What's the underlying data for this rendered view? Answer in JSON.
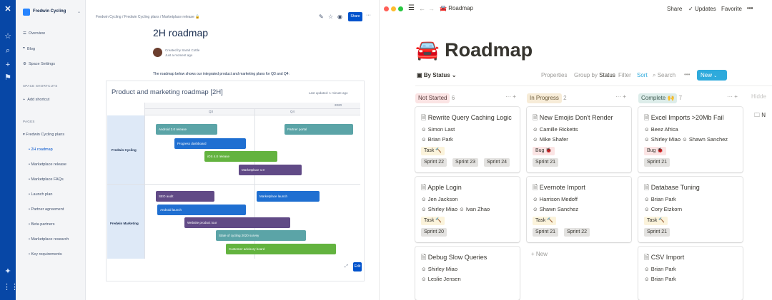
{
  "confluence": {
    "space_name": "Fredwin Cycling",
    "space_nav": [
      "Overview",
      "Blog",
      "Space Settings"
    ],
    "shortcuts_heading": "SPACE SHORTCUTS",
    "add_shortcut": "Add shortcut",
    "pages_heading": "PAGES",
    "page_tree_root": "Fredwin Cycling plans",
    "page_tree": [
      "2H roadmap",
      "Marketplace release",
      "Marketplace FAQs",
      "Launch plan",
      "Partner agreement",
      "Beta partners",
      "Marketplace research",
      "Key requirements"
    ],
    "breadcrumb": "Fredwin Cycling  /  Fredwin Cycling plans  /  Marketplace release",
    "share_label": "Share",
    "page_title": "2H roadmap",
    "author": "Created by Sarah Cottle",
    "time": "Just a moment ago",
    "intro": "The roadmap below shows our integrated product and marketing plans for Q3 and Q4:",
    "roadmap_title": "Product and marketing roadmap [2H]",
    "last_updated": "Last updated: 1 minute ago",
    "year": "2020",
    "quarters": [
      "Q3",
      "Q4"
    ],
    "lanes": [
      "Fredwin Cycling",
      "Fredwin Marketing"
    ],
    "bars": [
      {
        "label": "Android 3.0 release",
        "color": "#5ba4a7"
      },
      {
        "label": "Partner portal",
        "color": "#5ba4a7"
      },
      {
        "label": "Progress dashboard",
        "color": "#1f6fd1"
      },
      {
        "label": "iOS 4.0 release",
        "color": "#63b33f"
      },
      {
        "label": "Marketplace 1.0",
        "color": "#614a86"
      },
      {
        "label": "SEO audit",
        "color": "#614a86"
      },
      {
        "label": "Marketplace launch",
        "color": "#1f6fd1"
      },
      {
        "label": "Android launch",
        "color": "#1f6fd1"
      },
      {
        "label": "Website product tour",
        "color": "#614a86"
      },
      {
        "label": "State of cycling 2020 survey",
        "color": "#5ba4a7"
      },
      {
        "label": "Customer advisory board",
        "color": "#63b33f"
      }
    ],
    "edit_label": "Edit"
  },
  "notion": {
    "title_icon": "🚘",
    "breadcrumb_title": "Roadmap",
    "top_actions": [
      "Share",
      "Updates",
      "Favorite",
      "•••"
    ],
    "page_title": "Roadmap",
    "view_label": "By Status",
    "toolbar": {
      "properties": "Properties",
      "group_by": "Group by",
      "group_value": "Status",
      "filter": "Filter",
      "sort": "Sort",
      "search": "Search",
      "more": "•••",
      "new": "New"
    },
    "columns": [
      {
        "name": "Not Started",
        "count": "6",
        "bg": "#fbe4e4",
        "color": "#5a3d3d"
      },
      {
        "name": "In Progress",
        "count": "2",
        "bg": "#f7ecd8",
        "color": "#6b5a3a"
      },
      {
        "name": "Complete 🙌",
        "count": "7",
        "bg": "#ddedea",
        "color": "#3d5a50"
      }
    ],
    "hidden_label": "Hidde",
    "add_new": "+ New",
    "cards": [
      {
        "title": "Rewrite Query Caching Logic",
        "people": [
          "Simon Last",
          "Brian Park"
        ],
        "type": "Task 🔨",
        "sprints": [
          "Sprint 22",
          "Sprint 23",
          "Sprint 24"
        ]
      },
      {
        "title": "Apple Login",
        "people": [
          "Jen Jackson",
          "Shirley Miao",
          "Ivan Zhao"
        ],
        "type": "Task 🔨",
        "sprints": [
          "Sprint 20"
        ]
      },
      {
        "title": "Debug Slow Queries",
        "people": [
          "Shirley Miao",
          "Leslie Jensen"
        ]
      },
      {
        "title": "New Emojis Don't Render",
        "people": [
          "Camille Ricketts",
          "Mike Shafer"
        ],
        "type": "Bug 🐞",
        "sprints": [
          "Sprint 21"
        ]
      },
      {
        "title": "Evernote Import",
        "people": [
          "Harrison Medoff",
          "Shawn Sanchez"
        ],
        "type": "Task 🔨",
        "sprints": [
          "Sprint 21",
          "Sprint 22"
        ]
      },
      {
        "title": "Excel Imports >20Mb Fail",
        "people": [
          "Beez Africa",
          "Shirley Miao",
          "Shawn Sanchez"
        ],
        "type": "Bug 🐞",
        "sprints": [
          "Sprint 21"
        ]
      },
      {
        "title": "Database Tuning",
        "people": [
          "Brian Park",
          "Cory Etzkorn"
        ],
        "type": "Task 🔨",
        "sprints": [
          "Sprint 21"
        ]
      },
      {
        "title": "CSV Import",
        "people": [
          "Brian Park",
          "Brian Park"
        ]
      }
    ]
  }
}
